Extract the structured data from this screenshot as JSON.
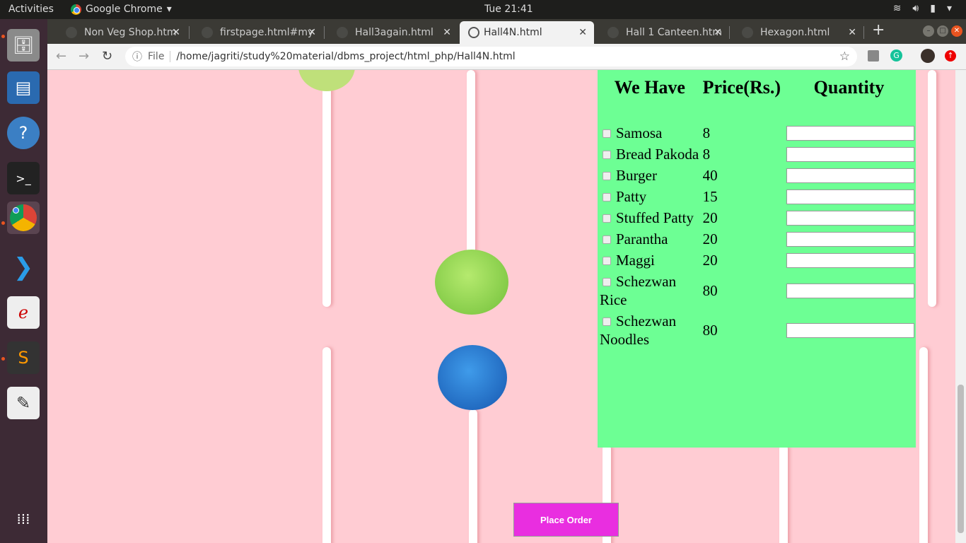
{
  "system": {
    "activities": "Activities",
    "app_name": "Google Chrome",
    "clock": "Tue 21:41"
  },
  "tabs": [
    {
      "label": "Non Veg Shop.htm"
    },
    {
      "label": "firstpage.html#my"
    },
    {
      "label": "Hall3again.html"
    },
    {
      "label": "Hall4N.html",
      "active": true
    },
    {
      "label": "Hall 1 Canteen.htm"
    },
    {
      "label": "Hexagon.html"
    }
  ],
  "toolbar": {
    "file_label": "File",
    "url": "/home/jagriti/study%20material/dbms_project/html_php/Hall4N.html"
  },
  "menu": {
    "headers": [
      "We Have",
      "Price(Rs.)",
      "Quantity"
    ],
    "items": [
      {
        "name": "Samosa",
        "price": "8",
        "quantity": ""
      },
      {
        "name": "Bread Pakoda",
        "price": "8",
        "quantity": ""
      },
      {
        "name": "Burger",
        "price": "40",
        "quantity": ""
      },
      {
        "name": "Patty",
        "price": "15",
        "quantity": ""
      },
      {
        "name": "Stuffed Patty",
        "price": "20",
        "quantity": ""
      },
      {
        "name": "Parantha",
        "price": "20",
        "quantity": ""
      },
      {
        "name": "Maggi",
        "price": "20",
        "quantity": ""
      },
      {
        "name": "Schezwan Rice",
        "price": "80",
        "quantity": ""
      },
      {
        "name": "Schezwan Noodles",
        "price": "80",
        "quantity": ""
      }
    ]
  },
  "order_button": "Place Order",
  "colors": {
    "panel": "#6dff94",
    "background": "#ffccd3",
    "button": "#e92ee0"
  }
}
